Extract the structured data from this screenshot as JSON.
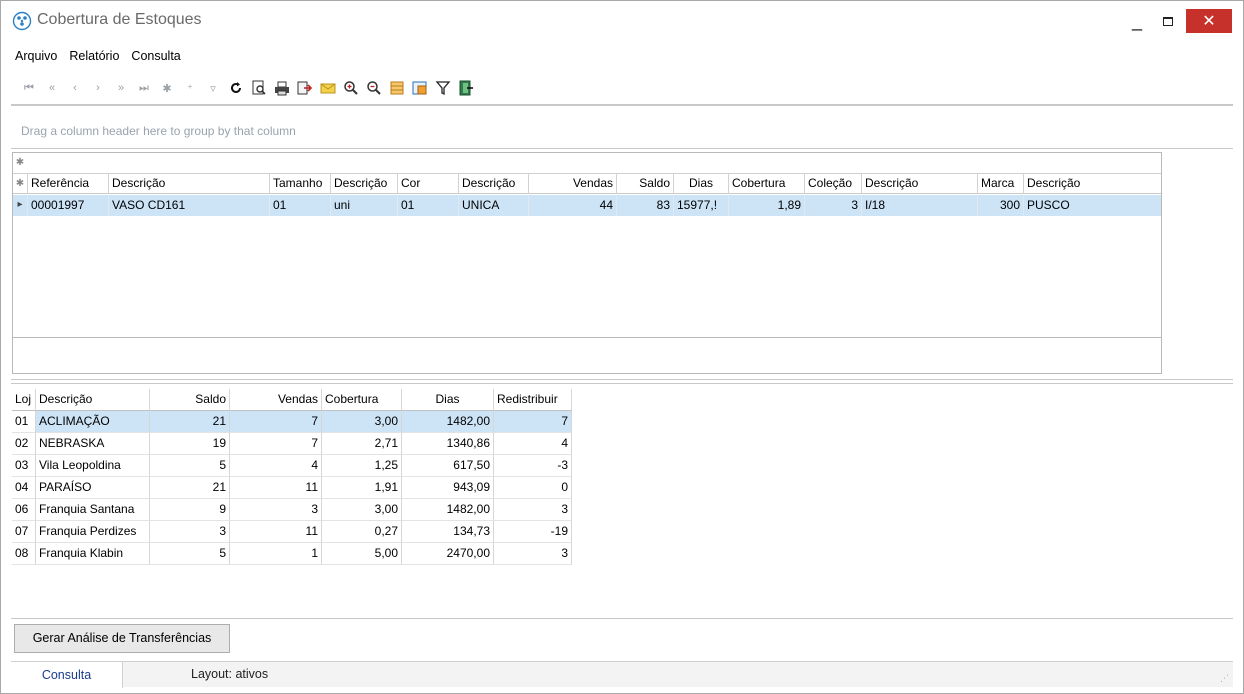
{
  "window": {
    "title": "Cobertura de Estoques",
    "minimize_glyph": "_",
    "close_glyph": "✕"
  },
  "menu": [
    "Arquivo",
    "Relatório",
    "Consulta"
  ],
  "toolbar_icons": [
    "first-record-icon",
    "prior-page-icon",
    "prior-record-icon",
    "next-record-icon",
    "next-page-icon",
    "last-record-icon",
    "insert-record-icon",
    "append-record-icon",
    "post-edit-icon",
    "refresh-icon",
    "print-preview-icon",
    "print-icon",
    "export-icon",
    "email-icon",
    "zoom-in-icon",
    "zoom-out-icon",
    "layout-icon",
    "grid-settings-icon",
    "filter-icon",
    "exit-icon"
  ],
  "group_panel": {
    "hint": "Drag a column header here to group by that column"
  },
  "main_grid": {
    "columns": [
      "Referência",
      "Descrição",
      "Tamanho",
      "Descrição",
      "Cor",
      "Descrição",
      "Vendas",
      "Saldo",
      "Dias",
      "Cobertura",
      "Coleção",
      "Descrição",
      "Marca",
      "Descrição"
    ],
    "rows": [
      [
        "00001997",
        "VASO CD161",
        "01",
        "uni",
        "01",
        "UNICA",
        "44",
        "83",
        "15977,!",
        "1,89",
        "3",
        "I/18",
        "300",
        "PUSCO"
      ]
    ]
  },
  "store_grid": {
    "columns": [
      "Loj",
      "Descrição",
      "Saldo",
      "Vendas",
      "Cobertura",
      "Dias",
      "Redistribuir"
    ],
    "rows": [
      [
        "01",
        "ACLIMAÇÃO",
        "21",
        "7",
        "3,00",
        "1482,00",
        "7"
      ],
      [
        "02",
        "NEBRASKA",
        "19",
        "7",
        "2,71",
        "1340,86",
        "4"
      ],
      [
        "03",
        "Vila Leopoldina",
        "5",
        "4",
        "1,25",
        "617,50",
        "-3"
      ],
      [
        "04",
        "PARAÍSO",
        "21",
        "11",
        "1,91",
        "943,09",
        "0"
      ],
      [
        "06",
        "Franquia Santana",
        "9",
        "3",
        "3,00",
        "1482,00",
        "3"
      ],
      [
        "07",
        "Franquia Perdizes",
        "3",
        "11",
        "0,27",
        "134,73",
        "-19"
      ],
      [
        "08",
        "Franquia Klabin",
        "5",
        "1",
        "5,00",
        "2470,00",
        "3"
      ]
    ]
  },
  "actions": {
    "generate_label": "Gerar Análise de Transferências"
  },
  "status": {
    "tab_label": "Consulta",
    "layout_label": "Layout: ativos"
  },
  "colors": {
    "selection": "#cde4f7",
    "close_button": "#c7312b",
    "status_tab_text": "#1b3d8c"
  }
}
